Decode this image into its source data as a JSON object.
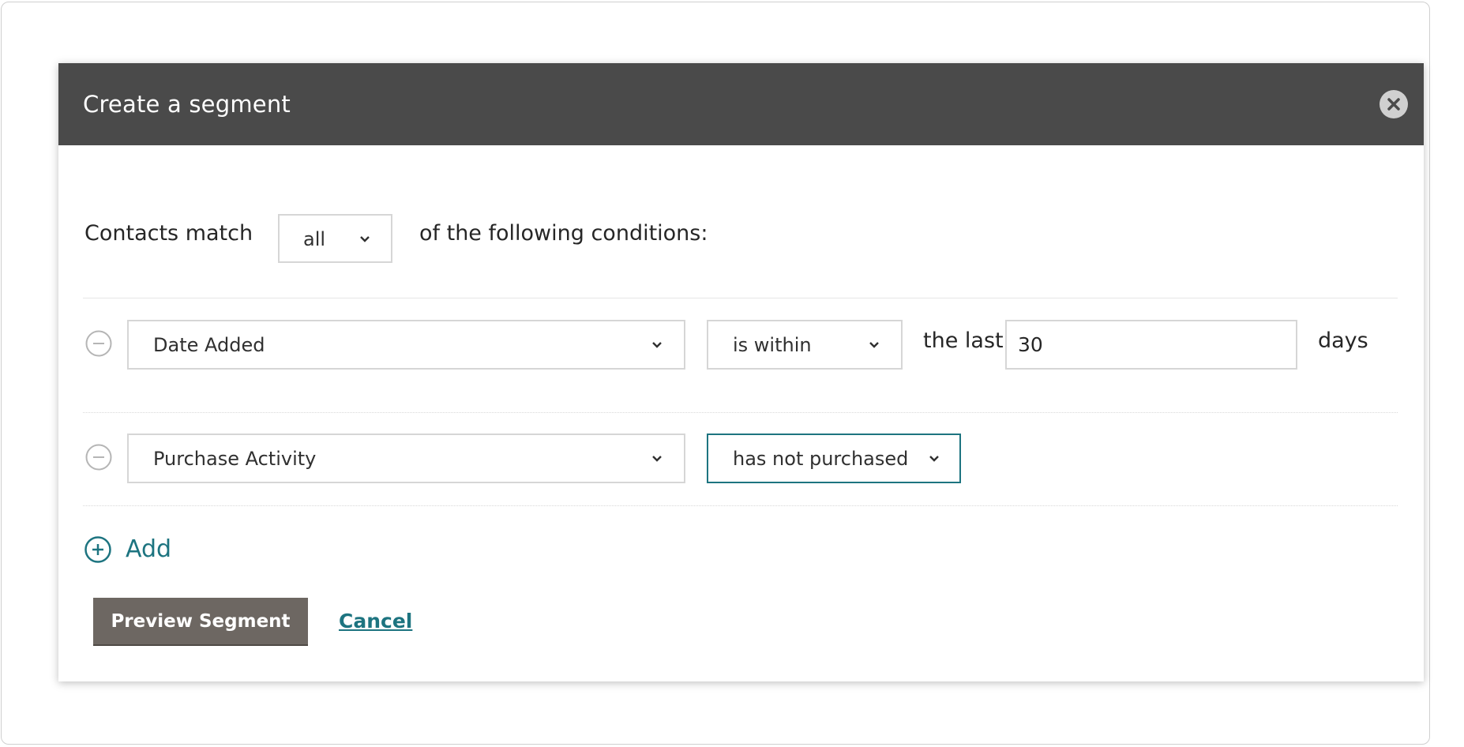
{
  "modal": {
    "title": "Create a segment"
  },
  "match": {
    "prefix": "Contacts match",
    "selected": "all",
    "suffix": "of the following conditions:"
  },
  "conditions": [
    {
      "field": "Date Added",
      "operator": "is within",
      "pre_value_text": "the last",
      "value": "30",
      "unit": "days"
    },
    {
      "field": "Purchase Activity",
      "operator": "has not purchased"
    }
  ],
  "actions": {
    "add_label": "Add",
    "preview_label": "Preview Segment",
    "cancel_label": "Cancel"
  },
  "colors": {
    "header_bg": "#4a4a4a",
    "accent": "#1d7480",
    "primary_button": "#6d6762"
  },
  "icons": {
    "close": "close-icon",
    "chevron": "chevron-down-icon",
    "remove": "minus-circle-icon",
    "add": "plus-circle-icon"
  }
}
